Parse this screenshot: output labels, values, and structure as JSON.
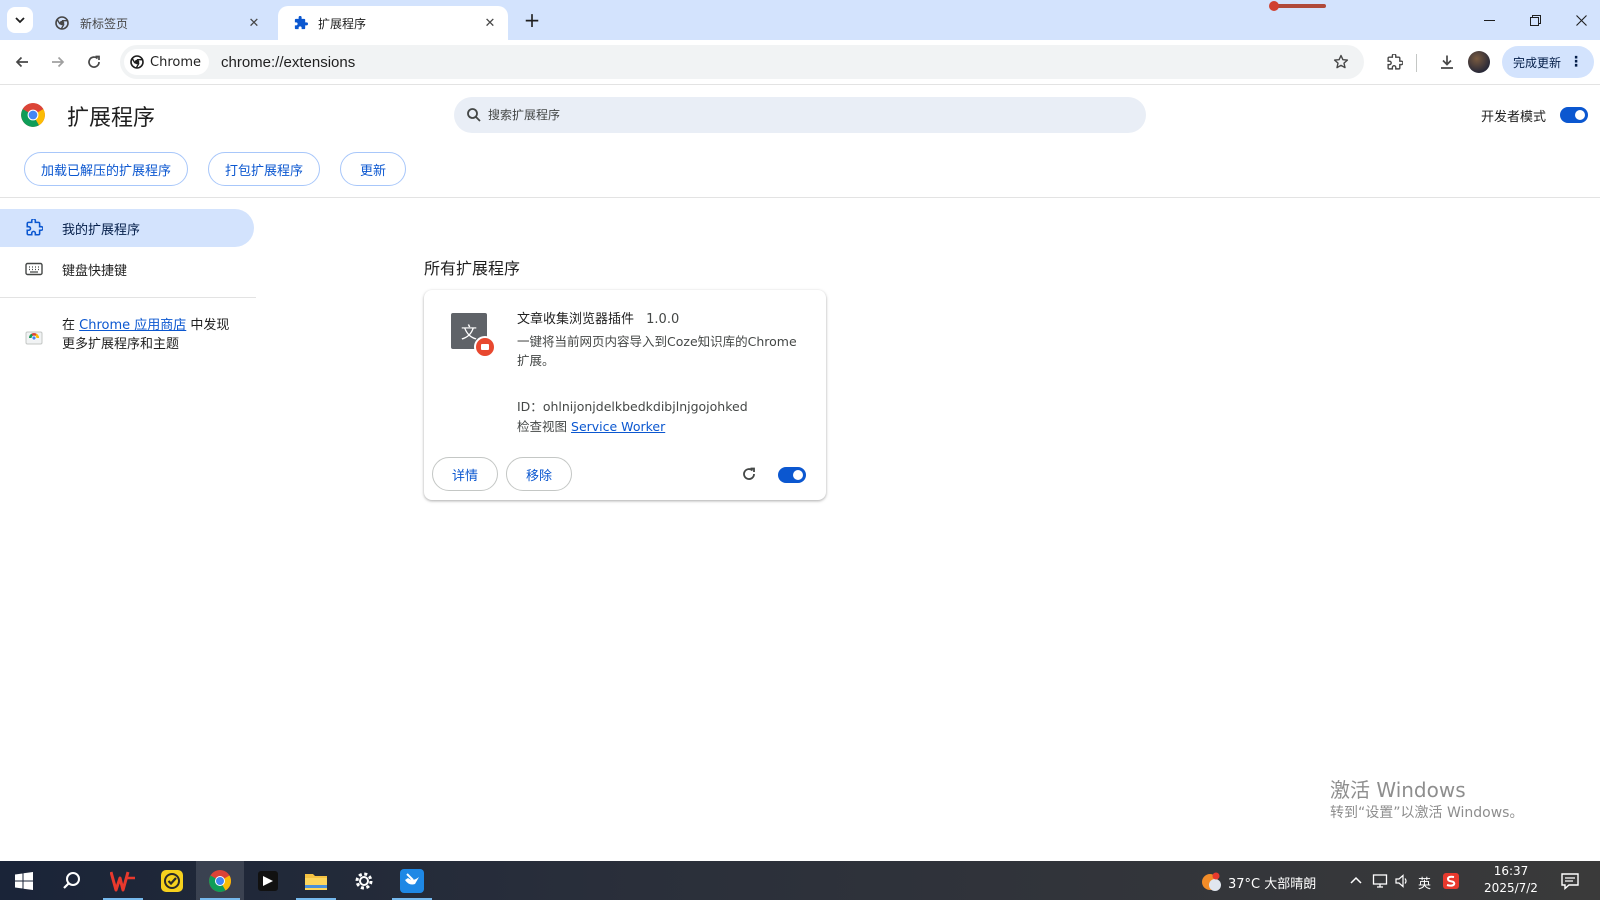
{
  "browser": {
    "tabs": [
      {
        "label": "新标签页",
        "active": false
      },
      {
        "label": "扩展程序",
        "active": true
      }
    ],
    "omnibox": {
      "chip": "Chrome",
      "url": "chrome://extensions"
    },
    "update_button": "完成更新"
  },
  "page": {
    "title": "扩展程序",
    "search_placeholder": "搜索扩展程序",
    "dev_mode_label": "开发者模式",
    "dev_mode_on": true,
    "actions": [
      "加载已解压的扩展程序",
      "打包扩展程序",
      "更新"
    ]
  },
  "sidebar": {
    "items": [
      {
        "label": "我的扩展程序",
        "selected": true,
        "icon": "extension-icon"
      },
      {
        "label": "键盘快捷键",
        "selected": false,
        "icon": "keyboard-icon"
      }
    ],
    "webstore": {
      "prefix": "在",
      "link": "Chrome 应用商店",
      "suffix": "中发现更多扩展程序和主题"
    }
  },
  "main": {
    "section_title": "所有扩展程序",
    "extension": {
      "icon_glyph": "文",
      "name": "文章收集浏览器插件",
      "version": "1.0.0",
      "description": "一键将当前网页内容导入到Coze知识库的Chrome扩展。",
      "id_label": "ID：",
      "id": "ohlnijonjdelkbedkdibjlnjgojohked",
      "inspect_label": "检查视图",
      "inspect_link": "Service Worker",
      "details_button": "详情",
      "remove_button": "移除",
      "enabled": true
    }
  },
  "watermark": {
    "line1": "激活 Windows",
    "line2": "转到“设置”以激活 Windows。"
  },
  "taskbar": {
    "weather": "37°C  大部晴朗",
    "ime": "英",
    "time": "16:37",
    "date": "2025/7/2"
  },
  "colors": {
    "accent": "#0b57d0",
    "tab_strip": "#d3e3fd",
    "selected": "#d3e3fd"
  }
}
